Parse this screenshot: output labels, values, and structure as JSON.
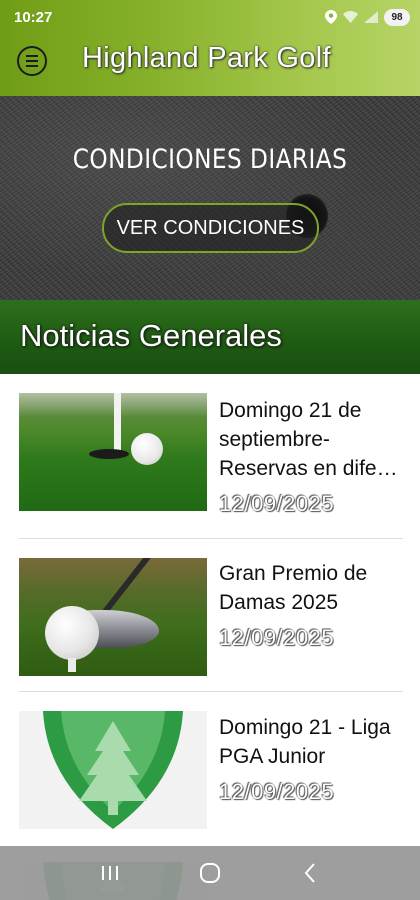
{
  "status_bar": {
    "time": "10:27",
    "battery": "98"
  },
  "app_bar": {
    "title": "Highland Park Golf",
    "menu_icon": "menu-icon"
  },
  "hero": {
    "title": "CONDICIONES DIARIAS",
    "button_label": "VER CONDICIONES"
  },
  "section": {
    "title": "Noticias Generales"
  },
  "news": [
    {
      "title": "Domingo 21 de septiembre- Reservas en dife…",
      "date": "12/09/2025",
      "image": "golf-ball-hole-image"
    },
    {
      "title": "Gran Premio de Damas 2025",
      "date": "12/09/2025",
      "image": "golf-driver-ball-image"
    },
    {
      "title": "Domingo 21 - Liga PGA Junior",
      "date": "12/09/2025",
      "image": "club-shield-logo"
    }
  ],
  "nav": {
    "recents": "recents-icon",
    "home": "home-icon",
    "back": "back-icon"
  },
  "colors": {
    "primary": "#7da529",
    "section": "#1f5c13",
    "text": "#111111"
  }
}
